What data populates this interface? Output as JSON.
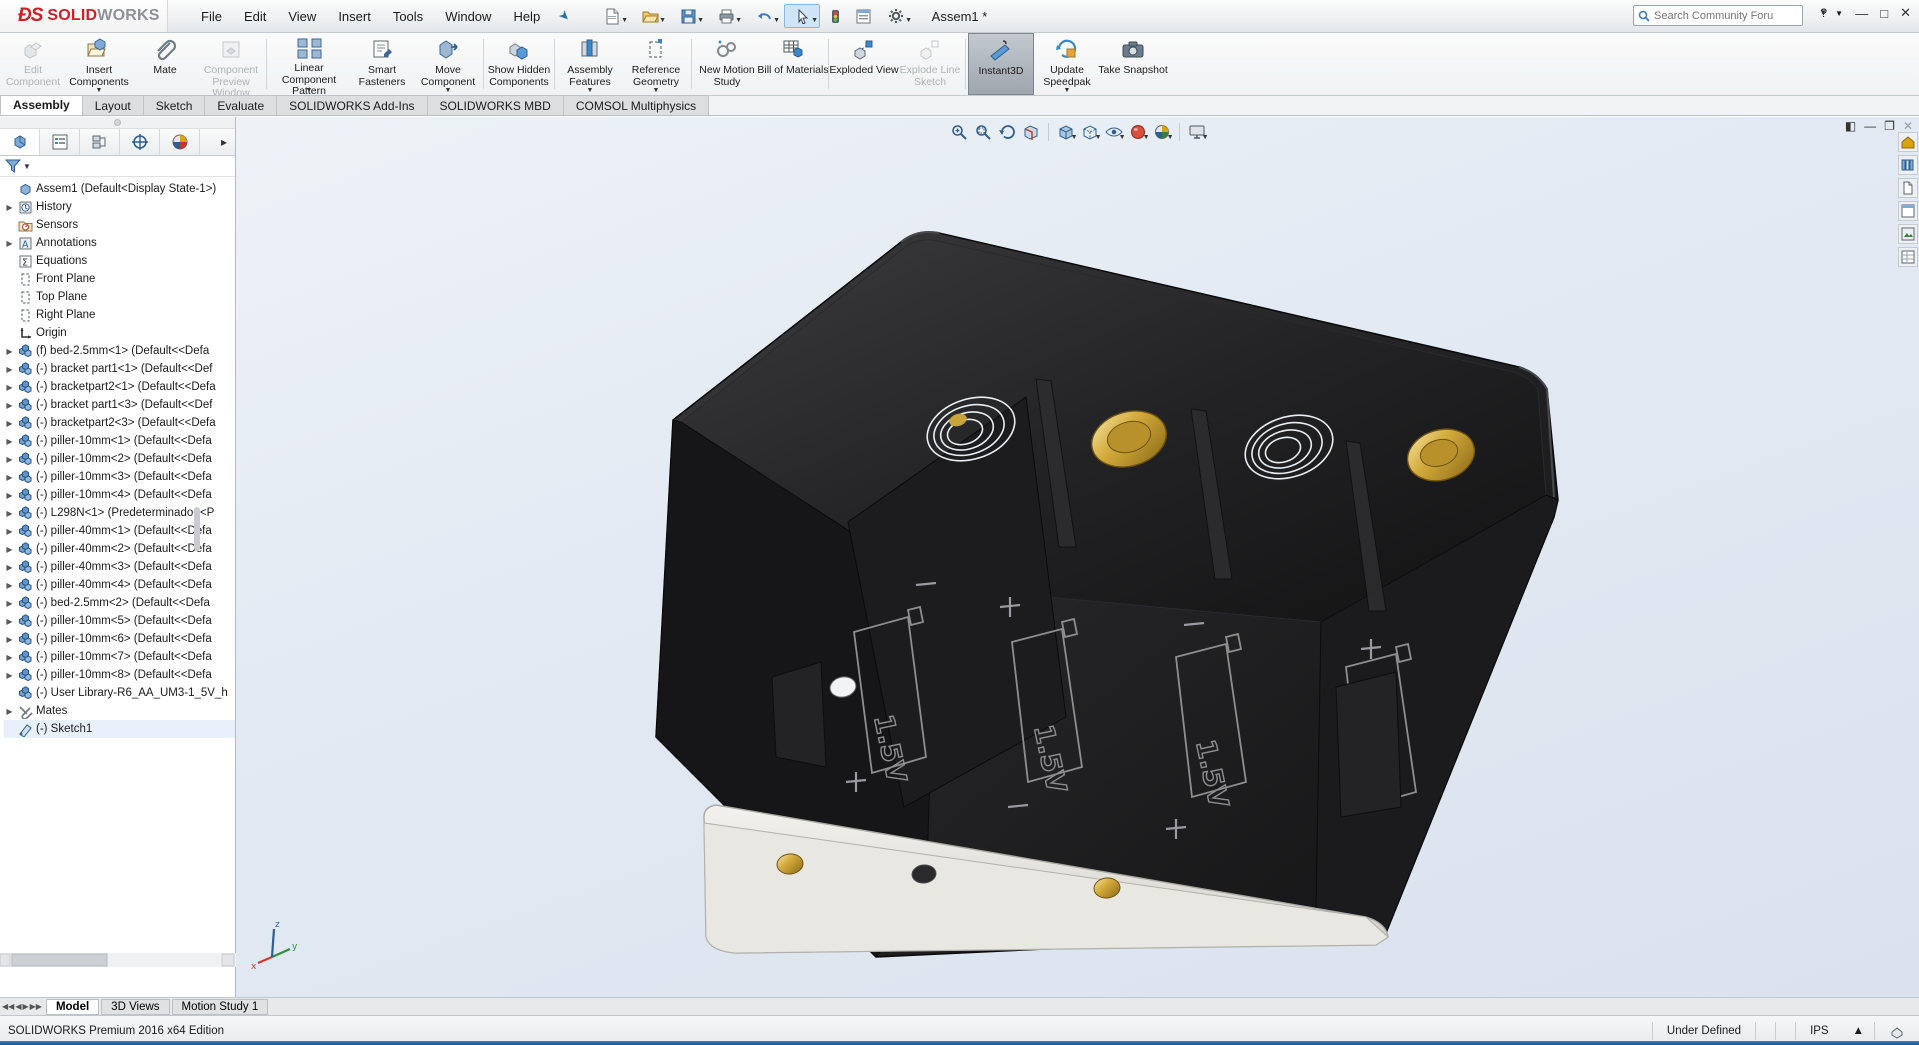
{
  "app": {
    "brand_primary": "SOLID",
    "brand_secondary": "WORKS",
    "logo_mark": "DS",
    "title": "Assem1 *",
    "accent_color": "#cf2027",
    "selection_color": "#3a6fb0"
  },
  "menu": {
    "items": [
      {
        "label": "File",
        "name": "menu-file"
      },
      {
        "label": "Edit",
        "name": "menu-edit"
      },
      {
        "label": "View",
        "name": "menu-view"
      },
      {
        "label": "Insert",
        "name": "menu-insert"
      },
      {
        "label": "Tools",
        "name": "menu-tools"
      },
      {
        "label": "Window",
        "name": "menu-window"
      },
      {
        "label": "Help",
        "name": "menu-help"
      }
    ],
    "pin_icon": "pushpin-icon"
  },
  "quick_access": {
    "buttons": [
      {
        "name": "new-document-button",
        "icon": "new-document-icon"
      },
      {
        "name": "open-document-button",
        "icon": "open-folder-icon"
      },
      {
        "name": "save-button",
        "icon": "save-disk-icon"
      },
      {
        "name": "print-button",
        "icon": "printer-icon"
      },
      {
        "name": "undo-button",
        "icon": "undo-arrow-icon"
      },
      {
        "name": "select-button",
        "icon": "cursor-arrow-icon"
      },
      {
        "name": "rebuild-button",
        "icon": "traffic-light-icon"
      },
      {
        "name": "display-manager-button",
        "icon": "list-panel-icon"
      },
      {
        "name": "options-button",
        "icon": "gear-icon"
      }
    ]
  },
  "search": {
    "placeholder": "Search Community Forum",
    "icon": "search-icon",
    "value": ""
  },
  "window_controls": {
    "help": "?",
    "minimize": "—",
    "maximize": "□",
    "close": "✕"
  },
  "ribbon": {
    "buttons": [
      {
        "name": "edit-component-button",
        "label": "Edit Component",
        "icon": "edit-component-icon",
        "disabled": true,
        "caret": false
      },
      {
        "name": "insert-components-button",
        "label": "Insert Components",
        "icon": "insert-components-icon",
        "disabled": false,
        "caret": true
      },
      {
        "name": "mate-button",
        "label": "Mate",
        "icon": "mate-paperclip-icon",
        "disabled": false,
        "caret": false
      },
      {
        "name": "component-preview-window-button",
        "label": "Component Preview Window",
        "icon": "component-preview-icon",
        "disabled": true,
        "caret": false
      },
      {
        "name": "linear-component-pattern-button",
        "label": "Linear Component Pattern",
        "icon": "linear-pattern-icon",
        "disabled": false,
        "caret": true
      },
      {
        "name": "smart-fasteners-button",
        "label": "Smart Fasteners",
        "icon": "smart-fasteners-icon",
        "disabled": false,
        "caret": false
      },
      {
        "name": "move-component-button",
        "label": "Move Component",
        "icon": "move-component-icon",
        "disabled": false,
        "caret": true
      },
      {
        "name": "show-hidden-components-button",
        "label": "Show Hidden Components",
        "icon": "show-hidden-icon",
        "disabled": false,
        "caret": false
      },
      {
        "name": "assembly-features-button",
        "label": "Assembly Features",
        "icon": "assembly-features-icon",
        "disabled": false,
        "caret": true
      },
      {
        "name": "reference-geometry-button",
        "label": "Reference Geometry",
        "icon": "reference-geometry-icon",
        "disabled": false,
        "caret": true
      },
      {
        "name": "new-motion-study-button",
        "label": "New Motion Study",
        "icon": "motion-study-icon",
        "disabled": false,
        "caret": false
      },
      {
        "name": "bill-of-materials-button",
        "label": "Bill of Materials",
        "icon": "bom-icon",
        "disabled": false,
        "caret": false
      },
      {
        "name": "exploded-view-button",
        "label": "Exploded View",
        "icon": "exploded-view-icon",
        "disabled": false,
        "caret": false
      },
      {
        "name": "explode-line-sketch-button",
        "label": "Explode Line Sketch",
        "icon": "explode-line-icon",
        "disabled": true,
        "caret": false
      },
      {
        "name": "instant3d-button",
        "label": "Instant3D",
        "icon": "instant3d-icon",
        "disabled": false,
        "caret": false,
        "selected": true
      },
      {
        "name": "update-speedpak-button",
        "label": "Update Speedpak",
        "icon": "update-speedpak-icon",
        "disabled": false,
        "caret": true
      },
      {
        "name": "take-snapshot-button",
        "label": "Take Snapshot",
        "icon": "camera-icon",
        "disabled": false,
        "caret": false
      }
    ]
  },
  "command_tabs": [
    {
      "label": "Assembly",
      "name": "tab-assembly",
      "active": true
    },
    {
      "label": "Layout",
      "name": "tab-layout",
      "active": false
    },
    {
      "label": "Sketch",
      "name": "tab-sketch",
      "active": false
    },
    {
      "label": "Evaluate",
      "name": "tab-evaluate",
      "active": false
    },
    {
      "label": "SOLIDWORKS Add-Ins",
      "name": "tab-solidworks-addins",
      "active": false
    },
    {
      "label": "SOLIDWORKS MBD",
      "name": "tab-solidworks-mbd",
      "active": false
    },
    {
      "label": "COMSOL Multiphysics",
      "name": "tab-comsol-multiphysics",
      "active": false
    }
  ],
  "feature_manager": {
    "tabs": [
      {
        "name": "ptab-feature-manager",
        "icon": "feature-tree-icon",
        "active": true
      },
      {
        "name": "ptab-property-manager",
        "icon": "property-manager-icon",
        "active": false
      },
      {
        "name": "ptab-configuration-manager",
        "icon": "configuration-manager-icon",
        "active": false
      },
      {
        "name": "ptab-dimxpert-manager",
        "icon": "dimxpert-icon",
        "active": false
      },
      {
        "name": "ptab-display-manager",
        "icon": "display-manager-palette-icon",
        "active": false
      }
    ],
    "filter_icon": "filter-funnel-icon",
    "root": "Assem1  (Default<Display State-1>)",
    "items": [
      {
        "label": "History",
        "icon": "history-icon",
        "expandable": true,
        "indent": 1
      },
      {
        "label": "Sensors",
        "icon": "sensors-icon",
        "expandable": false,
        "indent": 1
      },
      {
        "label": "Annotations",
        "icon": "annotations-icon",
        "expandable": true,
        "indent": 1
      },
      {
        "label": "Equations",
        "icon": "equations-icon",
        "expandable": false,
        "indent": 1
      },
      {
        "label": "Front Plane",
        "icon": "plane-icon",
        "expandable": false,
        "indent": 1
      },
      {
        "label": "Top Plane",
        "icon": "plane-icon",
        "expandable": false,
        "indent": 1
      },
      {
        "label": "Right Plane",
        "icon": "plane-icon",
        "expandable": false,
        "indent": 1
      },
      {
        "label": "Origin",
        "icon": "origin-icon",
        "expandable": false,
        "indent": 1
      },
      {
        "label": "(f) bed-2.5mm<1>  (Default<<Defa",
        "icon": "component-icon",
        "expandable": true,
        "indent": 1
      },
      {
        "label": "(-) bracket part1<1>  (Default<<Def",
        "icon": "component-icon",
        "expandable": true,
        "indent": 1
      },
      {
        "label": "(-) bracketpart2<1>  (Default<<Defa",
        "icon": "component-icon",
        "expandable": true,
        "indent": 1
      },
      {
        "label": "(-) bracket part1<3>  (Default<<Def",
        "icon": "component-icon",
        "expandable": true,
        "indent": 1
      },
      {
        "label": "(-) bracketpart2<3>  (Default<<Defa",
        "icon": "component-icon",
        "expandable": true,
        "indent": 1
      },
      {
        "label": "(-) piller-10mm<1>  (Default<<Defa",
        "icon": "component-icon",
        "expandable": true,
        "indent": 1
      },
      {
        "label": "(-) piller-10mm<2>  (Default<<Defa",
        "icon": "component-icon",
        "expandable": true,
        "indent": 1
      },
      {
        "label": "(-) piller-10mm<3>  (Default<<Defa",
        "icon": "component-icon",
        "expandable": true,
        "indent": 1
      },
      {
        "label": "(-) piller-10mm<4>  (Default<<Defa",
        "icon": "component-icon",
        "expandable": true,
        "indent": 1
      },
      {
        "label": "(-) L298N<1>  (Predeterminado<<P",
        "icon": "component-icon",
        "expandable": true,
        "indent": 1
      },
      {
        "label": "(-) piller-40mm<1>  (Default<<Defa",
        "icon": "component-icon",
        "expandable": true,
        "indent": 1
      },
      {
        "label": "(-) piller-40mm<2>  (Default<<Defa",
        "icon": "component-icon",
        "expandable": true,
        "indent": 1
      },
      {
        "label": "(-) piller-40mm<3>  (Default<<Defa",
        "icon": "component-icon",
        "expandable": true,
        "indent": 1
      },
      {
        "label": "(-) piller-40mm<4>  (Default<<Defa",
        "icon": "component-icon",
        "expandable": true,
        "indent": 1
      },
      {
        "label": "(-) bed-2.5mm<2>  (Default<<Defa",
        "icon": "component-icon",
        "expandable": true,
        "indent": 1
      },
      {
        "label": "(-) piller-10mm<5>  (Default<<Defa",
        "icon": "component-icon",
        "expandable": true,
        "indent": 1
      },
      {
        "label": "(-) piller-10mm<6>  (Default<<Defa",
        "icon": "component-icon",
        "expandable": true,
        "indent": 1
      },
      {
        "label": "(-) piller-10mm<7>  (Default<<Defa",
        "icon": "component-icon",
        "expandable": true,
        "indent": 1
      },
      {
        "label": "(-) piller-10mm<8>  (Default<<Defa",
        "icon": "component-icon",
        "expandable": true,
        "indent": 1
      },
      {
        "label": "(-) User Library-R6_AA_UM3-1_5V_h",
        "icon": "component-icon",
        "expandable": false,
        "indent": 1
      },
      {
        "label": "Mates",
        "icon": "mates-folder-icon",
        "expandable": true,
        "indent": 1
      },
      {
        "label": "(-) Sketch1",
        "icon": "sketch-icon",
        "expandable": false,
        "indent": 1,
        "selected": true
      }
    ]
  },
  "view_toolbar": {
    "buttons": [
      {
        "name": "zoom-to-fit-button",
        "icon": "zoom-fit-icon",
        "caret": false
      },
      {
        "name": "zoom-to-area-button",
        "icon": "zoom-area-icon",
        "caret": false
      },
      {
        "name": "previous-view-button",
        "icon": "previous-view-icon",
        "caret": false
      },
      {
        "name": "section-view-button",
        "icon": "section-view-icon",
        "caret": false
      },
      {
        "name": "view-orientation-button",
        "icon": "view-orientation-cube-icon",
        "caret": true
      },
      {
        "name": "display-style-button",
        "icon": "display-style-icon",
        "caret": true
      },
      {
        "name": "hide-show-items-button",
        "icon": "hide-show-eye-icon",
        "caret": true
      },
      {
        "name": "edit-appearance-button",
        "icon": "appearance-sphere-icon",
        "caret": true
      },
      {
        "name": "apply-scene-button",
        "icon": "scene-icon",
        "caret": true
      },
      {
        "name": "view-settings-button",
        "icon": "view-settings-monitor-icon",
        "caret": true
      }
    ]
  },
  "doc_window_controls": {
    "restore_left": "◧",
    "minimize": "—",
    "maximize": "❐",
    "close": "✕"
  },
  "right_dock": {
    "buttons": [
      {
        "name": "dock-design-library-button",
        "icon": "home-icon"
      },
      {
        "name": "dock-file-explorer-button",
        "icon": "library-icon"
      },
      {
        "name": "dock-search-button",
        "icon": "document-icon"
      },
      {
        "name": "dock-view-palette-button",
        "icon": "palette-icon"
      },
      {
        "name": "dock-appearances-button",
        "icon": "appearances-icon"
      },
      {
        "name": "dock-custom-properties-button",
        "icon": "properties-icon"
      }
    ]
  },
  "triad": {
    "x_label": "x",
    "y_label": "y",
    "z_label": "z"
  },
  "bottom_tabs": [
    {
      "label": "Model",
      "name": "bottom-tab-model",
      "active": true
    },
    {
      "label": "3D Views",
      "name": "bottom-tab-3d-views",
      "active": false
    },
    {
      "label": "Motion Study 1",
      "name": "bottom-tab-motion-study-1",
      "active": false
    }
  ],
  "status_bar": {
    "left_text": "SOLIDWORKS Premium 2016 x64 Edition",
    "state": "Under Defined",
    "units": "IPS",
    "units_caret": "▲",
    "edit_icon": "editing-assembly-icon"
  }
}
